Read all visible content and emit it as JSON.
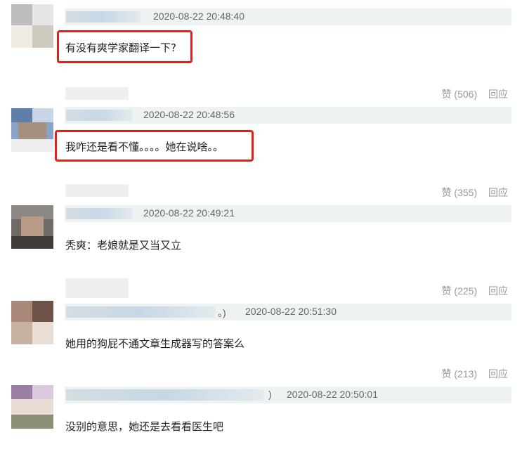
{
  "comments": [
    {
      "timestamp": "2020-08-22 20:48:40",
      "text": "有没有爽学家翻译一下?",
      "like_label": "赞 (506)",
      "reply_label": "回应"
    },
    {
      "timestamp": "2020-08-22 20:48:56",
      "text": "我咋还是看不懂。。。。她在说啥。。",
      "like_label": "赞 (355)",
      "reply_label": "回应"
    },
    {
      "timestamp": "2020-08-22 20:49:21",
      "text": "秃爽：老娘就是又当又立",
      "like_label": "赞 (225)",
      "reply_label": "回应"
    },
    {
      "timestamp": "2020-08-22 20:51:30",
      "text": "她用的狗屁不通文章生成器写的答案么",
      "like_label": "赞 (213)",
      "reply_label": "回应",
      "paren": "。)"
    },
    {
      "timestamp": "2020-08-22 20:50:01",
      "text": "没别的意思，她还是去看看医生吧",
      "paren": ")"
    }
  ],
  "colors": {
    "highlight_box": "#e3211c",
    "meta_bar_bg": "#edf2f2",
    "action_text": "#999999"
  }
}
